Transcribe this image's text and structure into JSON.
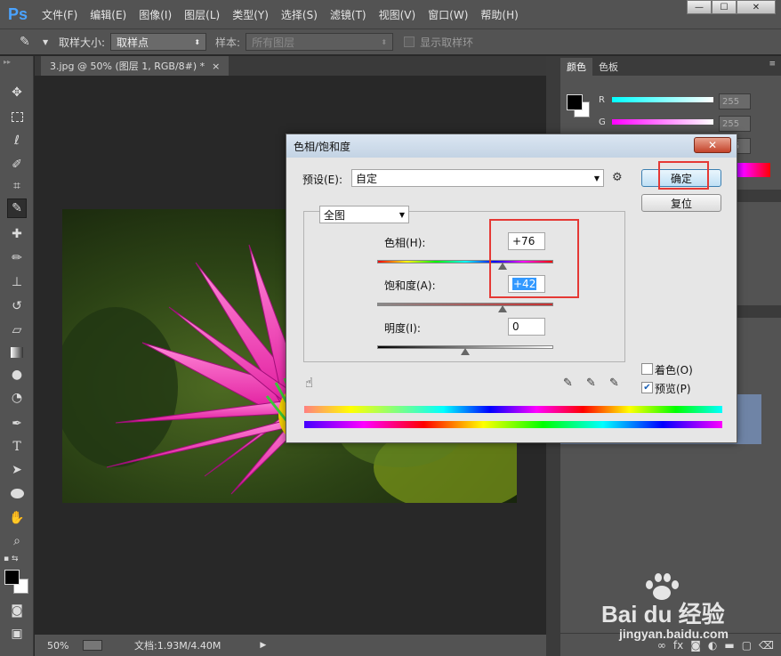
{
  "app": {
    "logo": "Ps",
    "menu": [
      "文件(F)",
      "编辑(E)",
      "图像(I)",
      "图层(L)",
      "类型(Y)",
      "选择(S)",
      "滤镜(T)",
      "视图(V)",
      "窗口(W)",
      "帮助(H)"
    ],
    "window_controls": [
      "—",
      "☐",
      "✕"
    ]
  },
  "options_bar": {
    "sample_size_label": "取样大小:",
    "sample_size_value": "取样点",
    "sample_label": "样本:",
    "sample_value": "所有图层",
    "show_ring_label": "显示取样环"
  },
  "document": {
    "tab_title": "3.jpg @ 50% (图层 1, RGB/8#) *",
    "tab_close": "×"
  },
  "status_bar": {
    "zoom": "50%",
    "doc_info": "文档:1.93M/4.40M"
  },
  "color_panel": {
    "tabs": [
      "颜色",
      "色板"
    ],
    "channels": [
      {
        "label": "R",
        "value": "255"
      },
      {
        "label": "G",
        "value": "255"
      },
      {
        "label": "B",
        "value": "255"
      }
    ]
  },
  "dialog": {
    "title": "色相/饱和度",
    "close": "✕",
    "preset_label": "预设(E):",
    "preset_value": "自定",
    "ok_button": "确定",
    "reset_button": "复位",
    "channel_value": "全图",
    "hue_label": "色相(H):",
    "hue_value": "+76",
    "saturation_label": "饱和度(A):",
    "saturation_value": "+42",
    "lightness_label": "明度(I):",
    "lightness_value": "0",
    "colorize_label": "着色(O)",
    "colorize_checked": false,
    "preview_label": "预览(P)",
    "preview_checked": true,
    "hue_fraction": 0.711,
    "saturation_fraction": 0.71,
    "lightness_fraction": 0.5
  },
  "watermark": {
    "brand": "Bai du 经验",
    "url": "jingyan.baidu.com"
  }
}
